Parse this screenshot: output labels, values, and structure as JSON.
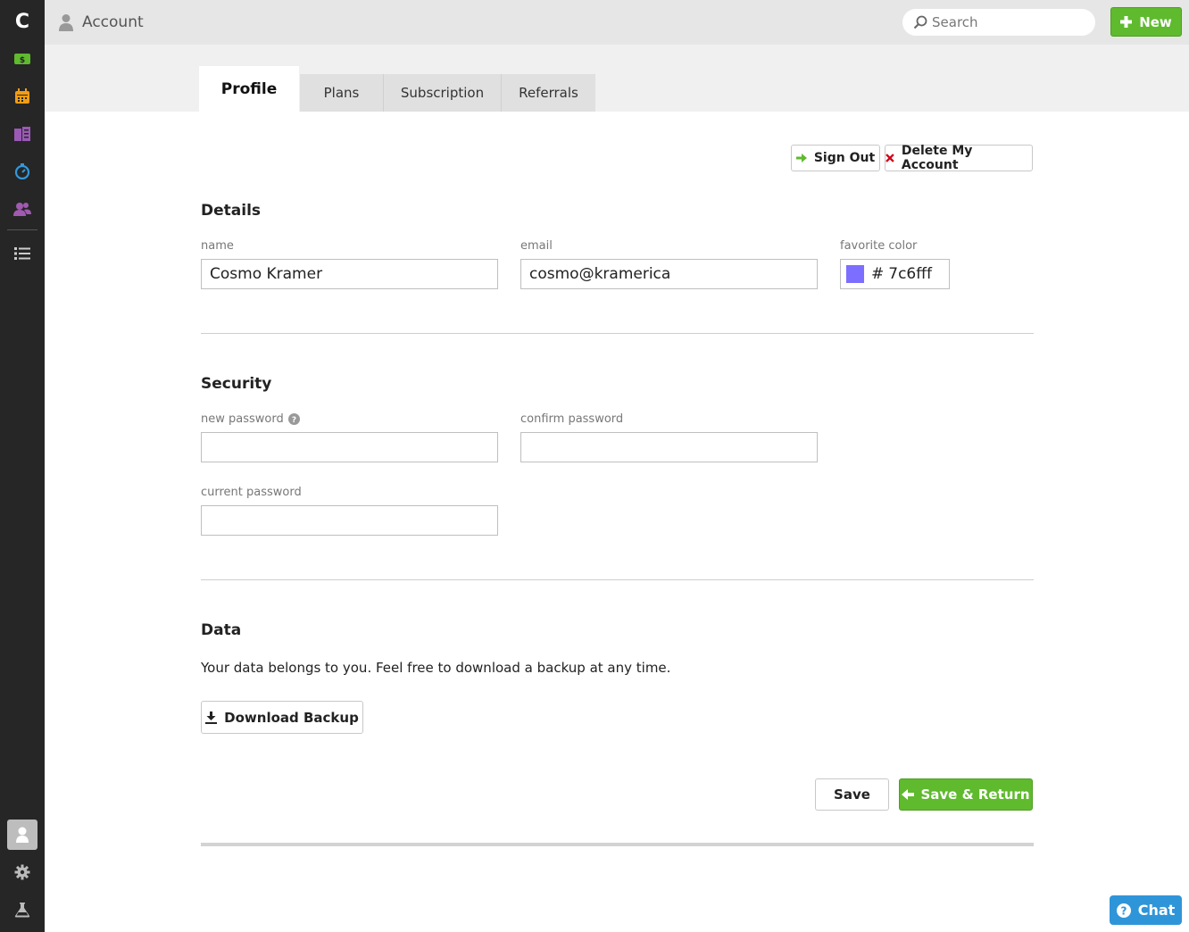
{
  "app": {
    "logo_letter": "C",
    "brand_color": "#5fba2e",
    "accent_blue": "#2f95d9"
  },
  "sidebar": {
    "items": [
      {
        "name": "money-icon",
        "color": "#5fba2e"
      },
      {
        "name": "calendar-icon",
        "color": "#f39c12"
      },
      {
        "name": "notes-icon",
        "color": "#9b59b6"
      },
      {
        "name": "timer-icon",
        "color": "#3498db"
      },
      {
        "name": "people-icon",
        "color": "#a05ab0"
      },
      {
        "name": "list-icon",
        "color": "#cccccc"
      }
    ],
    "bottom_items": [
      {
        "name": "account-icon",
        "active": true
      },
      {
        "name": "gear-icon"
      },
      {
        "name": "flask-icon"
      }
    ]
  },
  "header": {
    "title": "Account",
    "search_placeholder": "Search",
    "new_label": "New"
  },
  "tabs": [
    {
      "label": "Profile",
      "active": true
    },
    {
      "label": "Plans"
    },
    {
      "label": "Subscription"
    },
    {
      "label": "Referrals"
    }
  ],
  "actions": {
    "sign_out": "Sign Out",
    "delete_account": "Delete My Account"
  },
  "details": {
    "title": "Details",
    "name_label": "name",
    "name_value": "Cosmo Kramer",
    "email_label": "email",
    "email_value": "cosmo@kramerica",
    "color_label": "favorite color",
    "color_hash": "#",
    "color_value": "7c6fff",
    "color_swatch": "#7c6fff"
  },
  "security": {
    "title": "Security",
    "new_password_label": "new password",
    "confirm_password_label": "confirm password",
    "current_password_label": "current password"
  },
  "data_section": {
    "title": "Data",
    "description": "Your data belongs to you. Feel free to download a backup at any time.",
    "download_label": "Download Backup"
  },
  "footer": {
    "save_label": "Save",
    "save_return_label": "Save & Return",
    "chat_label": "Chat"
  }
}
